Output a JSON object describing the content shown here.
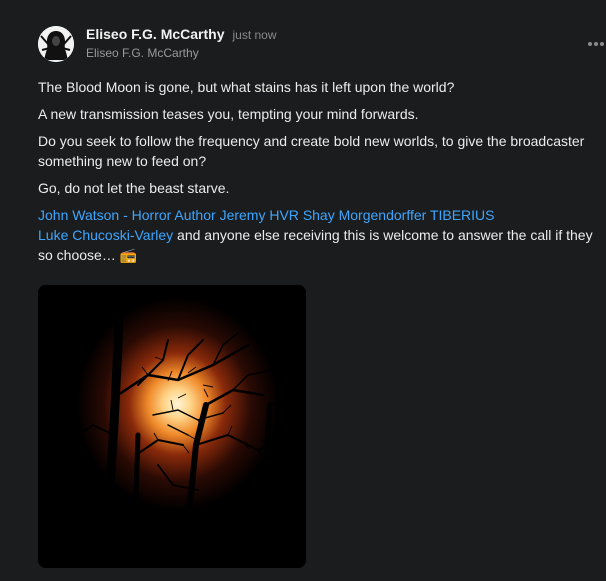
{
  "post": {
    "author_name": "Eliseo F.G. McCarthy",
    "timestamp": "just now",
    "author_subname": "Eliseo F.G. McCarthy",
    "avatar_icon": "hooded-figure-icon",
    "more_icon": "more-options-icon",
    "paragraphs": [
      "The Blood Moon is gone, but what stains has it left upon the world?",
      "A new transmission teases you, tempting your mind forwards.",
      "Do you seek to follow the frequency and create bold new worlds, to give the broadcaster something new to feed on?",
      "Go, do not let the beast starve."
    ],
    "mentions": [
      "John Watson - Horror Author",
      "Jeremy HVR",
      "Shay Morgendorffer",
      "TIBERIUS",
      "Luke Chucoski-Varley"
    ],
    "mention_suffix": " and anyone else receiving this is welcome to answer the call if they so choose… 📻",
    "image_subject": "moon-through-bare-branches",
    "colors": {
      "background": "#1b1c1d",
      "link": "#3ea6ff",
      "text": "#ececec",
      "muted": "#8a8a8a"
    }
  }
}
